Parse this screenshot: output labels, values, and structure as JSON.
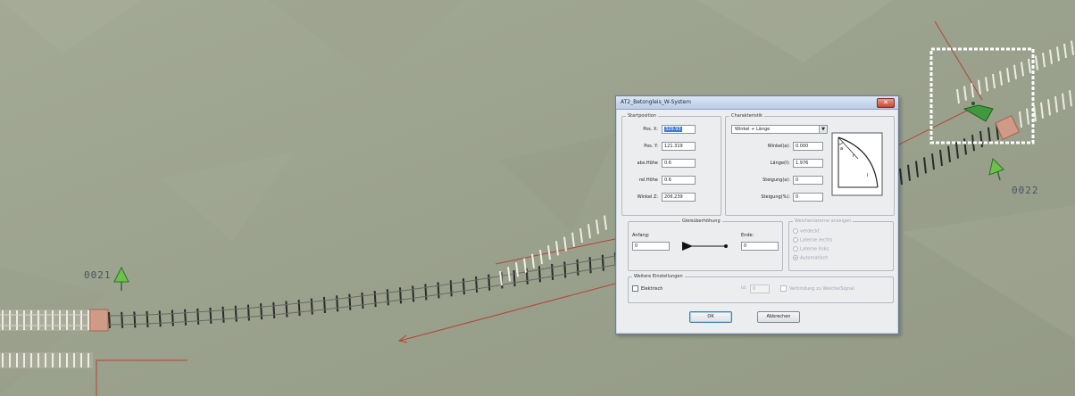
{
  "map": {
    "signal_labels": [
      "0021",
      "0022"
    ],
    "colors": {
      "background": "#9ca38f",
      "sleeper_concrete": "#e8e4d8",
      "sleeper_dark": "#2a2a2a",
      "rail_line": "#b54433",
      "signal_green": "#3f9a3f",
      "selection": "#ffffff"
    }
  },
  "dialog": {
    "title": "AT2_Betongleis_W-System",
    "close_glyph": "✕",
    "startposition": {
      "caption": "Startposition",
      "fields": [
        {
          "label": "Pos. X:",
          "value": "329.93",
          "selected": true
        },
        {
          "label": "Pos. Y:",
          "value": "121.319"
        },
        {
          "label": "abs.Höhe",
          "value": "0.6"
        },
        {
          "label": "rel.Höhe",
          "value": "0.6"
        },
        {
          "label": "Winkel Z:",
          "value": "206.239"
        }
      ]
    },
    "charakteristik": {
      "caption": "Charakteristik",
      "mode_value": "Winkel + Länge",
      "dropdown_glyph": "▼",
      "fields": [
        {
          "label": "Winkel(a):",
          "value": "0.000"
        },
        {
          "label": "Länge(l):",
          "value": "1.976"
        },
        {
          "label": "Steigung(a):",
          "value": "0"
        },
        {
          "label": "Steigung(%):",
          "value": "0"
        }
      ],
      "diagram_labels": {
        "angle": "a",
        "radius": "r",
        "length": "l"
      }
    },
    "gleisueberhoehung": {
      "caption": "Gleisüberhöhung",
      "start_label": "Anfang:",
      "start_value": "0",
      "end_label": "Ende:",
      "end_value": "0"
    },
    "weichenlaterne": {
      "caption": "Weichenlaterne anzeigen",
      "options": [
        "verdeckt",
        "Laterne rechts",
        "Laterne links",
        "Automatisch"
      ],
      "selected_index": 3
    },
    "weitere": {
      "caption": "Weitere Einstellungen",
      "elektrisch_label": "Elektrisch",
      "id_label": "Id:",
      "id_value": "0",
      "verbindung_label": "Verbindung zu Weiche/Signal"
    },
    "buttons": {
      "ok": "OK",
      "cancel": "Abbrechen"
    }
  }
}
